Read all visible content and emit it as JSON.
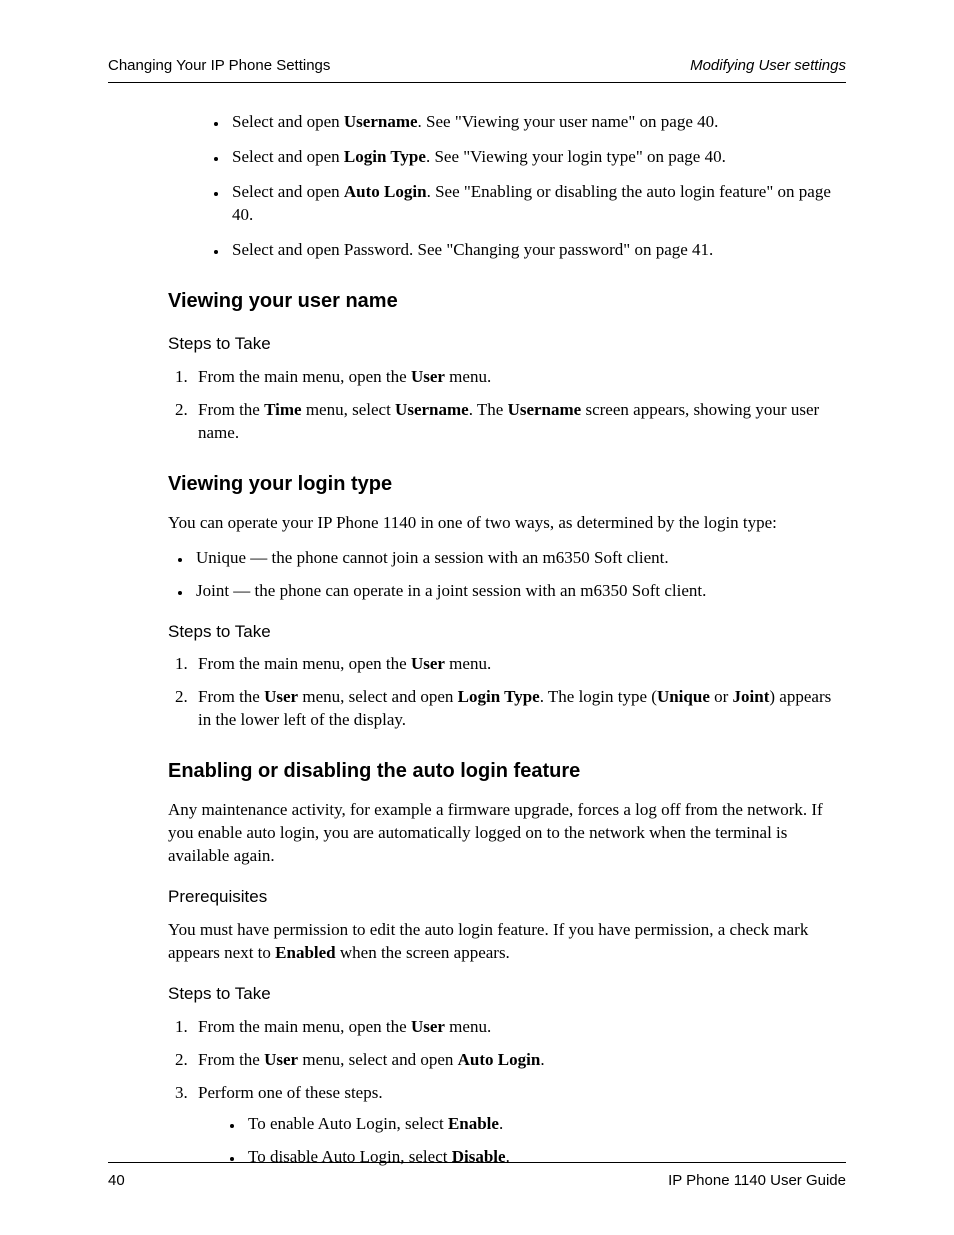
{
  "header": {
    "left": "Changing Your IP Phone Settings",
    "right": "Modifying User settings"
  },
  "intro_bullets": [
    {
      "pre": "Select and open ",
      "bold": "Username",
      "post": ". See \"Viewing your user name\" on page 40."
    },
    {
      "pre": "Select and open ",
      "bold": "Login Type",
      "post": ". See \"Viewing your login type\" on page 40."
    },
    {
      "pre": "Select and open ",
      "bold": "Auto Login",
      "post": ". See \"Enabling or disabling the auto login feature\" on page 40."
    },
    {
      "pre": "Select and open Password. See \"Changing your password\" on page 41.",
      "bold": "",
      "post": ""
    }
  ],
  "sec1": {
    "title": "Viewing your user name",
    "steps_label": "Steps to Take",
    "steps": [
      {
        "segments": [
          {
            "t": "From the main menu, open the "
          },
          {
            "t": "User",
            "b": true
          },
          {
            "t": " menu."
          }
        ]
      },
      {
        "segments": [
          {
            "t": "From the "
          },
          {
            "t": "Time",
            "b": true
          },
          {
            "t": " menu, select "
          },
          {
            "t": "Username",
            "b": true
          },
          {
            "t": ". The "
          },
          {
            "t": "Username",
            "b": true
          },
          {
            "t": " screen appears, showing your user name."
          }
        ]
      }
    ]
  },
  "sec2": {
    "title": "Viewing your login type",
    "intro": "You can operate your IP Phone 1140 in one of two ways, as determined by the login type:",
    "bullets": [
      "Unique — the phone cannot join a session with an m6350 Soft client.",
      "Joint — the phone can operate in a joint session with an m6350 Soft client."
    ],
    "steps_label": "Steps to Take",
    "steps": [
      {
        "segments": [
          {
            "t": "From the main menu, open the "
          },
          {
            "t": "User",
            "b": true
          },
          {
            "t": " menu."
          }
        ]
      },
      {
        "segments": [
          {
            "t": "From the "
          },
          {
            "t": "User",
            "b": true
          },
          {
            "t": " menu, select and open "
          },
          {
            "t": "Login Type",
            "b": true
          },
          {
            "t": ". The login type ("
          },
          {
            "t": "Unique",
            "b": true
          },
          {
            "t": " or "
          },
          {
            "t": "Joint",
            "b": true
          },
          {
            "t": ") appears in the lower left of the display."
          }
        ]
      }
    ]
  },
  "sec3": {
    "title": "Enabling or disabling the auto login feature",
    "intro": "Any maintenance activity, for example a firmware upgrade, forces a log off from the network. If you enable auto login, you are automatically logged on to the network when the terminal is available again.",
    "prereq_label": "Prerequisites",
    "prereq_segments": [
      {
        "t": "You must have permission to edit the auto login feature. If you have permission, a check mark appears next to "
      },
      {
        "t": "Enabled",
        "b": true
      },
      {
        "t": " when the screen appears."
      }
    ],
    "steps_label": "Steps to Take",
    "steps": [
      {
        "segments": [
          {
            "t": "From the main menu, open the "
          },
          {
            "t": "User",
            "b": true
          },
          {
            "t": " menu."
          }
        ]
      },
      {
        "segments": [
          {
            "t": "From the "
          },
          {
            "t": "User",
            "b": true
          },
          {
            "t": " menu, select and open "
          },
          {
            "t": "Auto Login",
            "b": true
          },
          {
            "t": "."
          }
        ]
      },
      {
        "segments": [
          {
            "t": "Perform one of these steps."
          }
        ],
        "sub": [
          {
            "segments": [
              {
                "t": "To enable Auto Login, select "
              },
              {
                "t": "Enable",
                "b": true
              },
              {
                "t": "."
              }
            ]
          },
          {
            "segments": [
              {
                "t": "To disable Auto Login, select "
              },
              {
                "t": "Disable",
                "b": true
              },
              {
                "t": "."
              }
            ]
          }
        ]
      }
    ]
  },
  "footer": {
    "page": "40",
    "doc": "IP Phone 1140 User Guide"
  }
}
